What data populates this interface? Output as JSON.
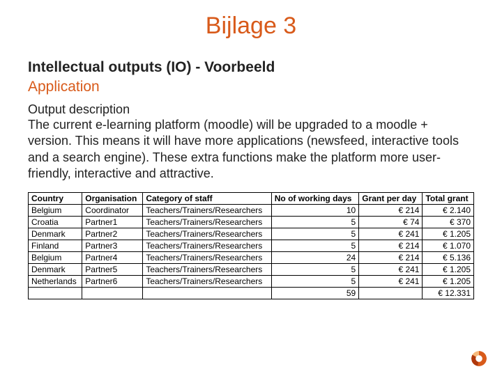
{
  "title": "Bijlage 3",
  "heading": "Intellectual outputs (IO) - Voorbeeld",
  "subheading": "Application",
  "desc_label": "Output description",
  "desc_text": "The current e-learning platform (moodle) will be upgraded to a moodle + version. This means it will have more applications (newsfeed, interactive tools and a search engine). These extra functions make the platform more user-friendly, interactive and attractive.",
  "table": {
    "headers": [
      "Country",
      "Organisation",
      "Category of staff",
      "No of working days",
      "Grant per day",
      "Total grant"
    ],
    "rows": [
      {
        "country": "Belgium",
        "org": "Coordinator",
        "cat": "Teachers/Trainers/Researchers",
        "days": "10",
        "grant": "€ 214",
        "total": "€ 2.140"
      },
      {
        "country": "Croatia",
        "org": "Partner1",
        "cat": "Teachers/Trainers/Researchers",
        "days": "5",
        "grant": "€ 74",
        "total": "€ 370"
      },
      {
        "country": "Denmark",
        "org": "Partner2",
        "cat": "Teachers/Trainers/Researchers",
        "days": "5",
        "grant": "€ 241",
        "total": "€ 1.205"
      },
      {
        "country": "Finland",
        "org": "Partner3",
        "cat": "Teachers/Trainers/Researchers",
        "days": "5",
        "grant": "€ 214",
        "total": "€ 1.070"
      },
      {
        "country": "Belgium",
        "org": "Partner4",
        "cat": "Teachers/Trainers/Researchers",
        "days": "24",
        "grant": "€ 214",
        "total": "€ 5.136"
      },
      {
        "country": "Denmark",
        "org": "Partner5",
        "cat": "Teachers/Trainers/Researchers",
        "days": "5",
        "grant": "€ 241",
        "total": "€ 1.205"
      },
      {
        "country": "Netherlands",
        "org": "Partner6",
        "cat": "Teachers/Trainers/Researchers",
        "days": "5",
        "grant": "€ 241",
        "total": "€ 1.205"
      }
    ],
    "totals": {
      "days": "59",
      "total": "€ 12.331"
    }
  }
}
